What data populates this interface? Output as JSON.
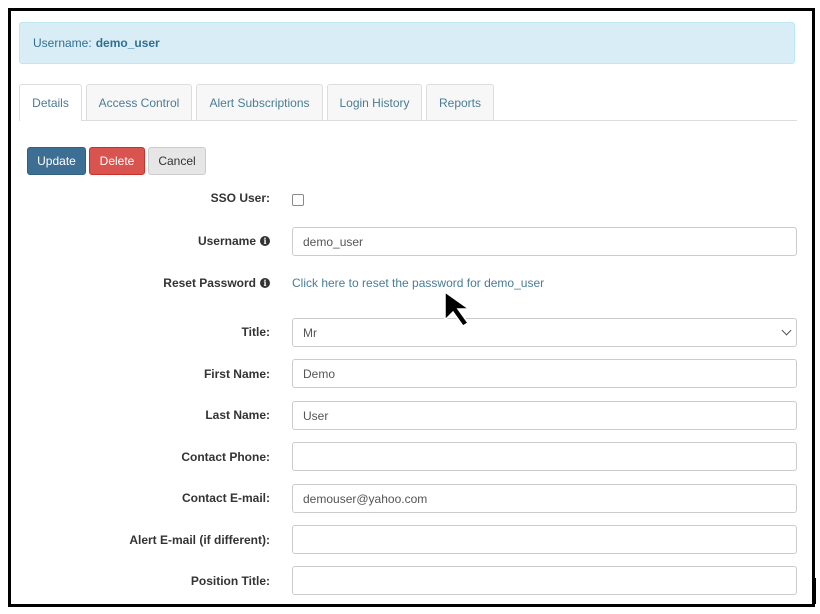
{
  "header": {
    "username_label": "Username:",
    "username_value": "demo_user"
  },
  "tabs": [
    {
      "label": "Details",
      "active": true
    },
    {
      "label": "Access Control",
      "active": false
    },
    {
      "label": "Alert Subscriptions",
      "active": false
    },
    {
      "label": "Login History",
      "active": false
    },
    {
      "label": "Reports",
      "active": false
    }
  ],
  "buttons": {
    "update": "Update",
    "delete": "Delete",
    "cancel": "Cancel"
  },
  "form": {
    "sso_label": "SSO User:",
    "sso_checked": false,
    "username_label": "Username",
    "username_value": "demo_user",
    "reset_label": "Reset Password",
    "reset_link": "Click here to reset the password for demo_user",
    "title_label": "Title:",
    "title_value": "Mr",
    "first_name_label": "First Name:",
    "first_name_value": "Demo",
    "last_name_label": "Last Name:",
    "last_name_value": "User",
    "phone_label": "Contact Phone:",
    "phone_value": "",
    "email_label": "Contact E-mail:",
    "email_value": "demouser@yahoo.com",
    "alert_email_label": "Alert E-mail (if different):",
    "alert_email_value": "",
    "position_label": "Position Title:",
    "position_value": ""
  },
  "icons": {
    "info": "info-circle-icon",
    "cursor": "mouse-pointer-icon",
    "select": "chevron-down-icon"
  },
  "colors": {
    "primary": "#3d6e94",
    "danger": "#d9534f",
    "link": "#4a7c94",
    "alert_bg": "#d9edf7"
  }
}
